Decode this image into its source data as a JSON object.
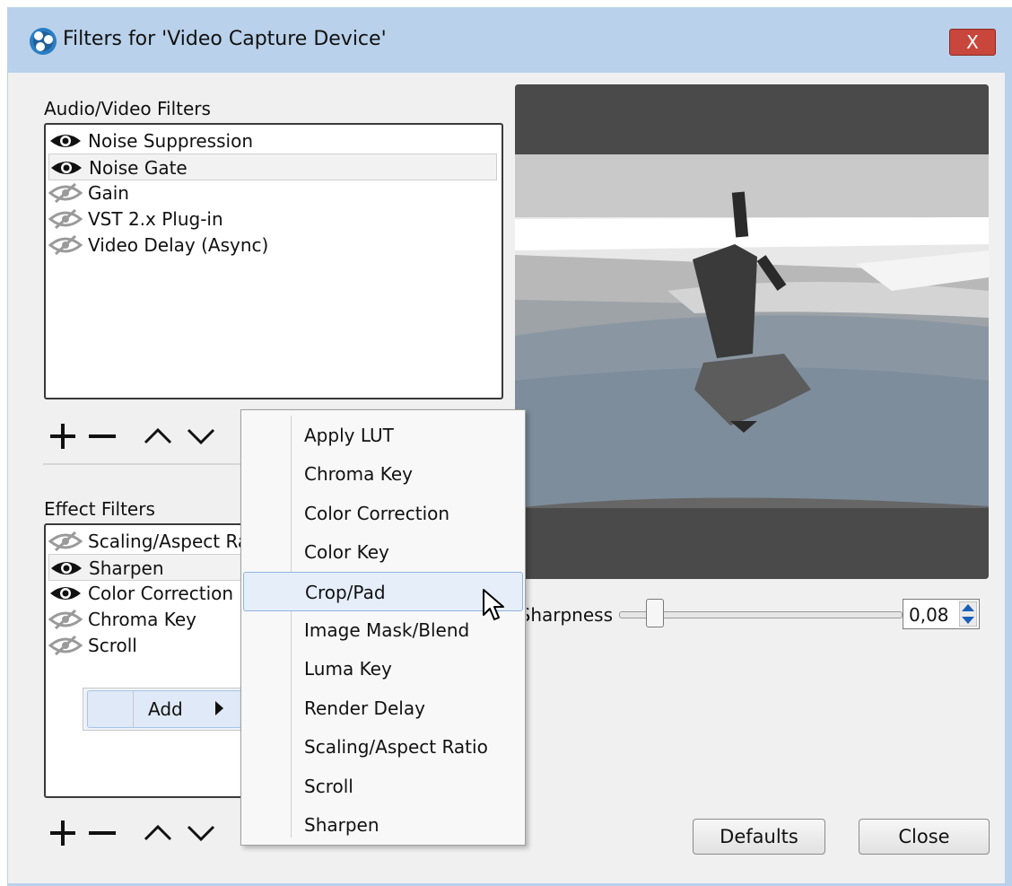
{
  "window": {
    "title": "Filters for 'Video Capture Device'",
    "close_label": "X"
  },
  "audio_video": {
    "heading": "Audio/Video Filters",
    "items": [
      {
        "label": "Noise Suppression",
        "visible": true
      },
      {
        "label": "Noise Gate",
        "visible": true
      },
      {
        "label": "Gain",
        "visible": false
      },
      {
        "label": "VST 2.x Plug-in",
        "visible": false
      },
      {
        "label": "Video Delay (Async)",
        "visible": false
      }
    ]
  },
  "effects": {
    "heading": "Effect Filters",
    "items": [
      {
        "label": "Scaling/Aspect Ra",
        "visible": false
      },
      {
        "label": "Sharpen",
        "visible": true
      },
      {
        "label": "Color Correction",
        "visible": true
      },
      {
        "label": "Chroma Key",
        "visible": false
      },
      {
        "label": "Scroll",
        "visible": false
      }
    ]
  },
  "context_menu": {
    "add_label": "Add"
  },
  "submenu": {
    "items": [
      "Apply LUT",
      "Chroma Key",
      "Color Correction",
      "Color Key",
      "Crop/Pad",
      "Image Mask/Blend",
      "Luma Key",
      "Render Delay",
      "Scaling/Aspect Ratio",
      "Scroll",
      "Sharpen"
    ],
    "highlighted": "Crop/Pad"
  },
  "properties": {
    "sharpness_label": "Sharpness",
    "sharpness_value": "0,08",
    "sharpness_fraction": 0.08
  },
  "buttons": {
    "defaults": "Defaults",
    "close": "Close"
  },
  "colors": {
    "titlebar": "#b9d1ea",
    "client": "#f0f0f0",
    "close_button": "#c9463d",
    "highlight": "#e5eef9"
  }
}
